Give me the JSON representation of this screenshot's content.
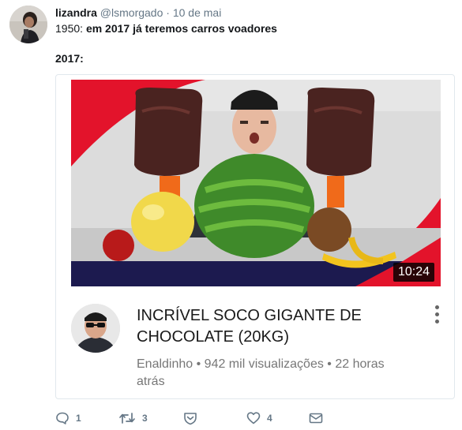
{
  "tweet": {
    "name": "lizandra",
    "handle": "@lsmorgado",
    "separator": "·",
    "date": "10 de mai",
    "line1_prefix": "1950: ",
    "line1_bold": "em 2017 já teremos carros voadores",
    "line2": "2017:"
  },
  "card": {
    "duration": "10:24",
    "title": "INCRÍVEL SOCO GIGANTE DE CHOCOLATE (20KG)",
    "meta": "Enaldinho • 942 mil visualizações • 22 horas atrás"
  },
  "actions": {
    "reply_count": "1",
    "retweet_count": "3",
    "like_count": "4"
  },
  "colors": {
    "accent_red": "#e3132b",
    "navy": "#1c1a4f",
    "action_gray": "#657786"
  },
  "icons": [
    "reply-icon",
    "retweet-icon",
    "shield-icon",
    "heart-icon",
    "envelope-icon",
    "more-vertical-icon"
  ]
}
